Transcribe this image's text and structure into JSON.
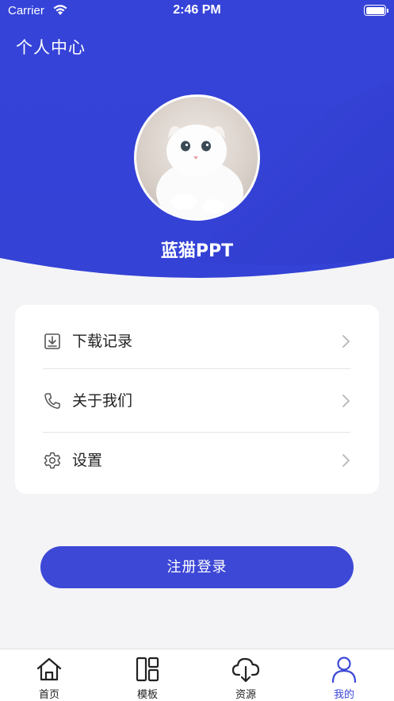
{
  "status_bar": {
    "carrier": "Carrier",
    "time": "2:46 PM"
  },
  "header": {
    "title": "个人中心",
    "username": "蓝猫PPT"
  },
  "menu": [
    {
      "label": "下载记录",
      "icon": "download-icon"
    },
    {
      "label": "关于我们",
      "icon": "phone-icon"
    },
    {
      "label": "设置",
      "icon": "gear-icon"
    }
  ],
  "login_button": {
    "label": "注册登录"
  },
  "tabbar": {
    "items": [
      {
        "label": "首页",
        "icon": "home-icon",
        "active": false
      },
      {
        "label": "模板",
        "icon": "layout-icon",
        "active": false
      },
      {
        "label": "资源",
        "icon": "cloud-download-icon",
        "active": false
      },
      {
        "label": "我的",
        "icon": "user-icon",
        "active": true
      }
    ]
  },
  "colors": {
    "accent": "#3d48d6",
    "header_dark": "#2a3ad0",
    "header_light": "#3c49dd",
    "background": "#f4f4f6"
  }
}
